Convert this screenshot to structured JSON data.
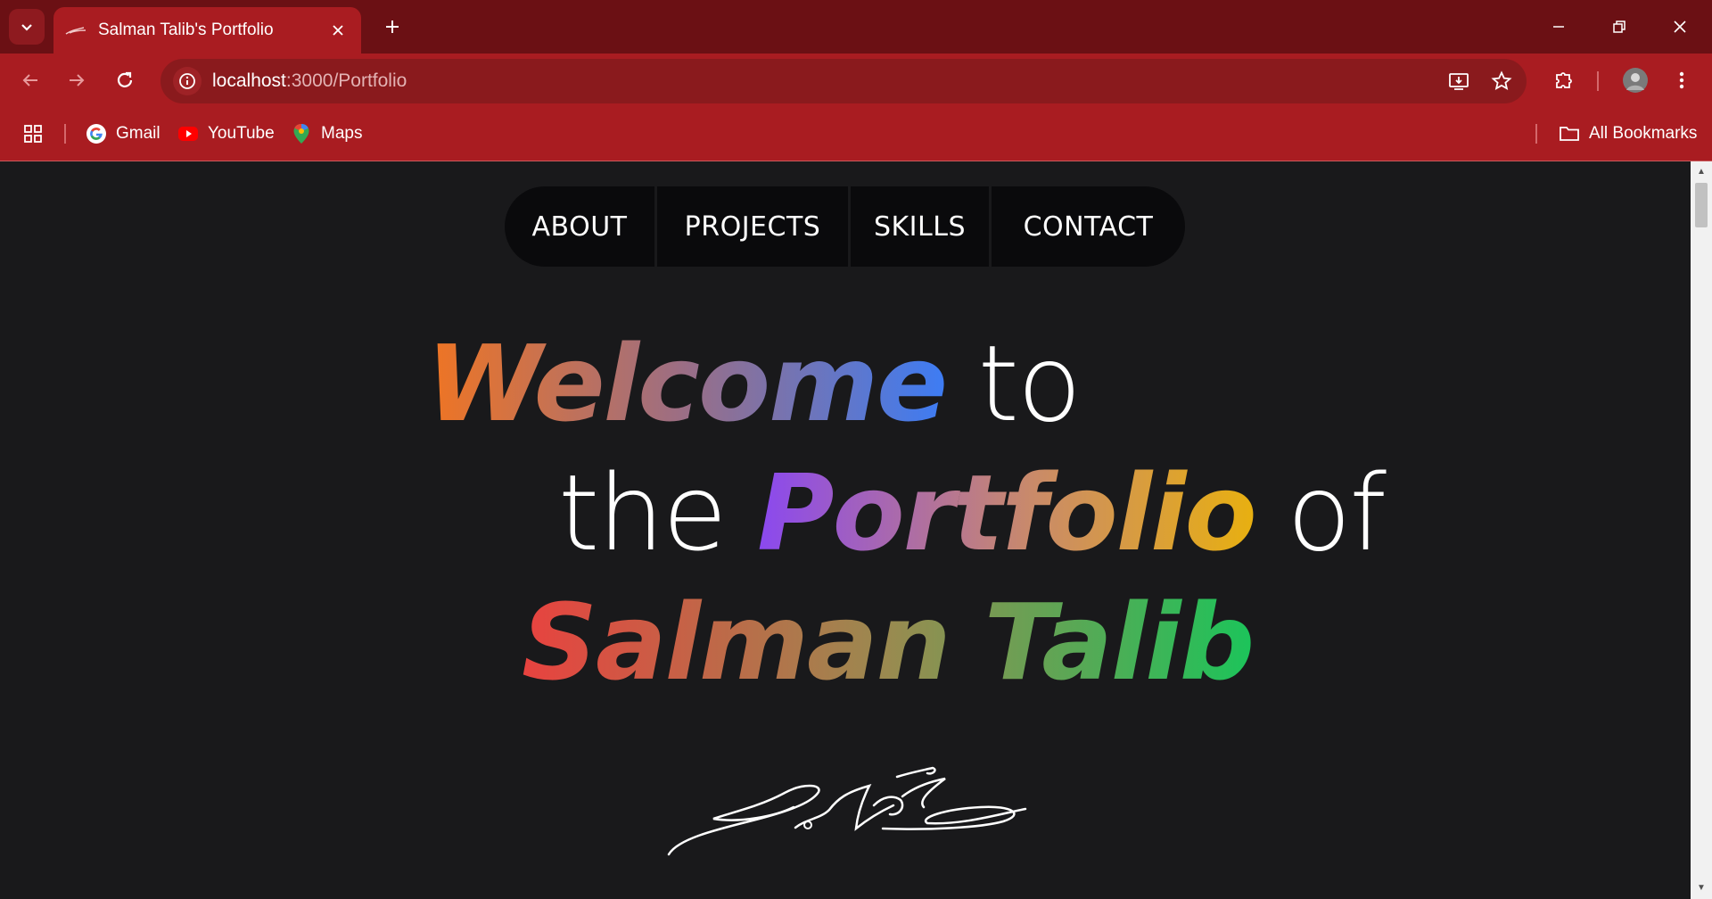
{
  "browser": {
    "tab_title": "Salman Talib's Portfolio",
    "url_host": "localhost",
    "url_rest": ":3000/Portfolio",
    "bookmarks": [
      {
        "label": "Gmail",
        "icon": "google-icon"
      },
      {
        "label": "YouTube",
        "icon": "youtube-icon"
      },
      {
        "label": "Maps",
        "icon": "maps-icon"
      }
    ],
    "all_bookmarks": "All Bookmarks",
    "theme_color": "#a91c21"
  },
  "page": {
    "nav": [
      "ABOUT",
      "PROJECTS",
      "SKILLS",
      "CONTACT"
    ],
    "hero": {
      "w1": "Welcome",
      "w2": "to",
      "w3": "the",
      "w4": "Portfolio",
      "w5": "of",
      "name": "Salman Talib"
    },
    "signature": "S Talib",
    "background": "#19191b"
  }
}
